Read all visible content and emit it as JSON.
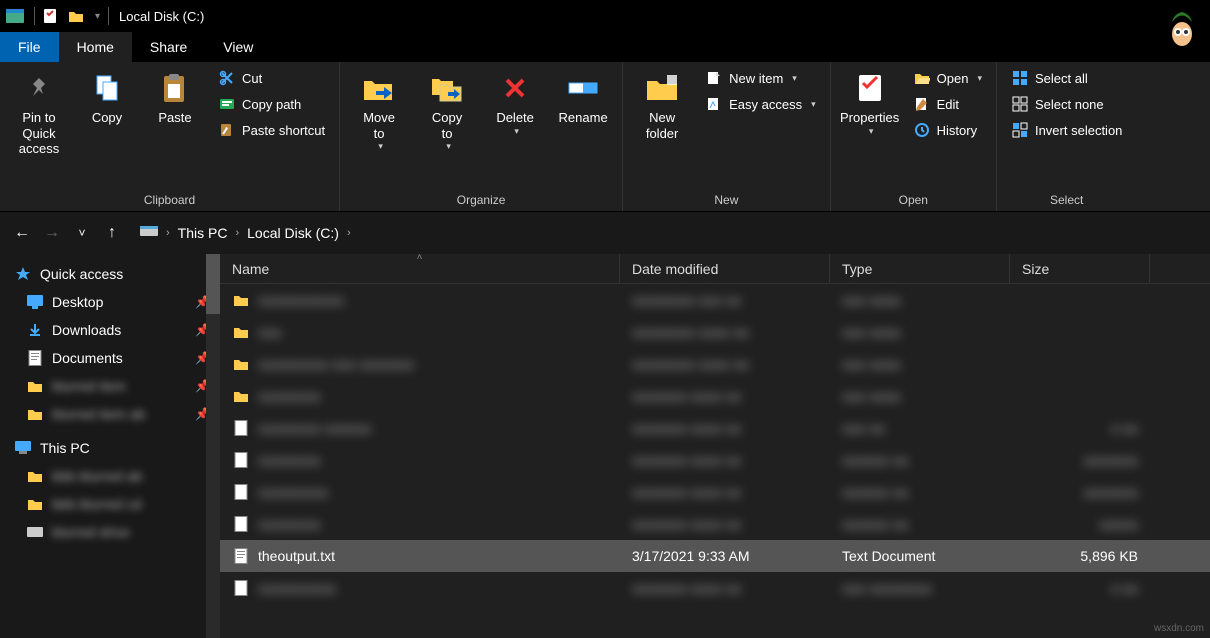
{
  "titlebar": {
    "title": "Local Disk (C:)"
  },
  "tabs": {
    "file": "File",
    "home": "Home",
    "share": "Share",
    "view": "View"
  },
  "ribbon": {
    "clipboard": {
      "pin": "Pin to Quick\naccess",
      "copy": "Copy",
      "paste": "Paste",
      "cut": "Cut",
      "copypath": "Copy path",
      "pasteshortcut": "Paste shortcut",
      "label": "Clipboard"
    },
    "organize": {
      "moveto": "Move\nto",
      "copyto": "Copy\nto",
      "delete": "Delete",
      "rename": "Rename",
      "label": "Organize"
    },
    "new": {
      "newfolder": "New\nfolder",
      "newitem": "New item",
      "easyaccess": "Easy access",
      "label": "New"
    },
    "open": {
      "properties": "Properties",
      "open": "Open",
      "edit": "Edit",
      "history": "History",
      "label": "Open"
    },
    "select": {
      "selectall": "Select all",
      "selectnone": "Select none",
      "invert": "Invert selection",
      "label": "Select"
    }
  },
  "breadcrumb": {
    "thispc": "This PC",
    "disk": "Local Disk (C:)"
  },
  "sidebar": {
    "quickaccess": "Quick access",
    "desktop": "Desktop",
    "downloads": "Downloads",
    "documents": "Documents",
    "thispc": "This PC"
  },
  "columns": {
    "name": "Name",
    "date": "Date modified",
    "type": "Type",
    "size": "Size"
  },
  "selected": {
    "name": "theoutput.txt",
    "date": "3/17/2021 9:33 AM",
    "type": "Text Document",
    "size": "5,896 KB"
  },
  "watermark": "wsxdn.com"
}
